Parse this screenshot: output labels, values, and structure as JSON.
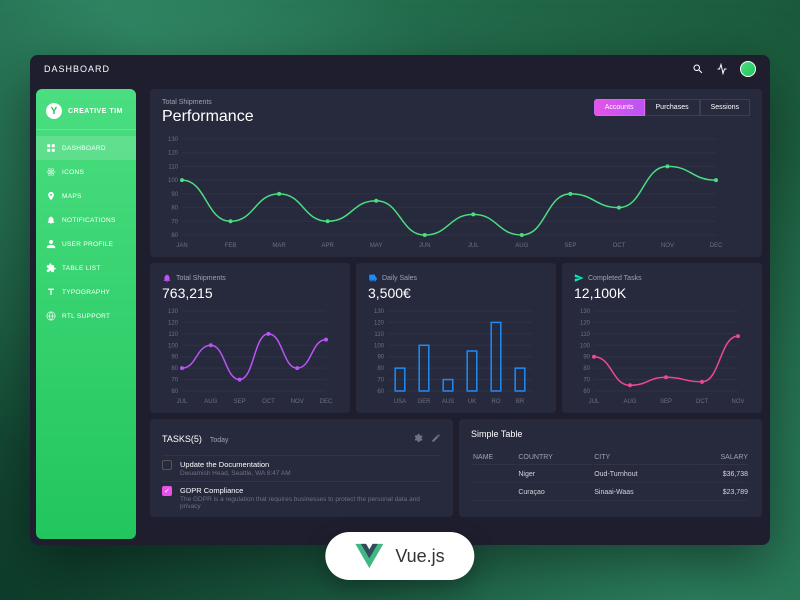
{
  "topbar": {
    "title": "DASHBOARD"
  },
  "brand": {
    "name": "CREATIVE TIM",
    "icon": "Y"
  },
  "sidebar": {
    "items": [
      {
        "label": "DASHBOARD",
        "icon": "grid",
        "active": true
      },
      {
        "label": "ICONS",
        "icon": "atom"
      },
      {
        "label": "MAPS",
        "icon": "pin"
      },
      {
        "label": "NOTIFICATIONS",
        "icon": "bell"
      },
      {
        "label": "USER PROFILE",
        "icon": "user"
      },
      {
        "label": "TABLE LIST",
        "icon": "puzzle"
      },
      {
        "label": "TYPOGRAPHY",
        "icon": "text"
      },
      {
        "label": "RTL SUPPORT",
        "icon": "globe"
      }
    ]
  },
  "perf": {
    "subtitle": "Total Shipments",
    "title": "Performance",
    "tabs": [
      "Accounts",
      "Purchases",
      "Sessions"
    ],
    "active_tab": "Accounts"
  },
  "stats": [
    {
      "label": "Total Shipments",
      "value": "763,215",
      "icon": "bell",
      "color": "#ba54f5"
    },
    {
      "label": "Daily Sales",
      "value": "3,500€",
      "icon": "delivery",
      "color": "#1d8cf8"
    },
    {
      "label": "Completed Tasks",
      "value": "12,100K",
      "icon": "send",
      "color": "#00f2c3"
    }
  ],
  "tasks": {
    "title": "TASKS(5)",
    "today": "Today",
    "items": [
      {
        "name": "Update the Documentation",
        "desc": "Dwuamish Head, Seattle, WA 8:47 AM",
        "checked": false
      },
      {
        "name": "GDPR Compliance",
        "desc": "The GDPR is a regulation that requires businesses to protect the personal data and privacy",
        "checked": true
      }
    ]
  },
  "table": {
    "title": "Simple Table",
    "headers": [
      "NAME",
      "COUNTRY",
      "CITY",
      "SALARY"
    ],
    "rows": [
      [
        "",
        "Niger",
        "Oud-Turnhout",
        "$36,738"
      ],
      [
        "",
        "Curaçao",
        "Sinaai-Waas",
        "$23,789"
      ]
    ]
  },
  "chart_data": [
    {
      "type": "line",
      "title": "Performance",
      "ylabel": "",
      "ylim": [
        60,
        130
      ],
      "categories": [
        "JAN",
        "FEB",
        "MAR",
        "APR",
        "MAY",
        "JUN",
        "JUL",
        "AUG",
        "SEP",
        "OCT",
        "NOV",
        "DEC"
      ],
      "values": [
        100,
        70,
        90,
        70,
        85,
        60,
        75,
        60,
        90,
        80,
        110,
        100
      ],
      "color": "#4ade80"
    },
    {
      "type": "line",
      "title": "Total Shipments",
      "ylim": [
        60,
        130
      ],
      "categories": [
        "JUL",
        "AUG",
        "SEP",
        "OCT",
        "NOV",
        "DEC"
      ],
      "values": [
        80,
        100,
        70,
        110,
        80,
        105
      ],
      "color": "#ba54f5"
    },
    {
      "type": "bar",
      "title": "Daily Sales",
      "ylim": [
        60,
        130
      ],
      "categories": [
        "USA",
        "GER",
        "AUS",
        "UK",
        "RO",
        "BR"
      ],
      "values": [
        80,
        100,
        70,
        95,
        120,
        80
      ],
      "color": "#1d8cf8"
    },
    {
      "type": "line",
      "title": "Completed Tasks",
      "ylim": [
        60,
        130
      ],
      "categories": [
        "JUL",
        "AUG",
        "SEP",
        "OCT",
        "NOV"
      ],
      "values": [
        90,
        65,
        72,
        68,
        108
      ],
      "color": "#ec4899"
    }
  ],
  "badge": {
    "text": "Vue.js"
  }
}
